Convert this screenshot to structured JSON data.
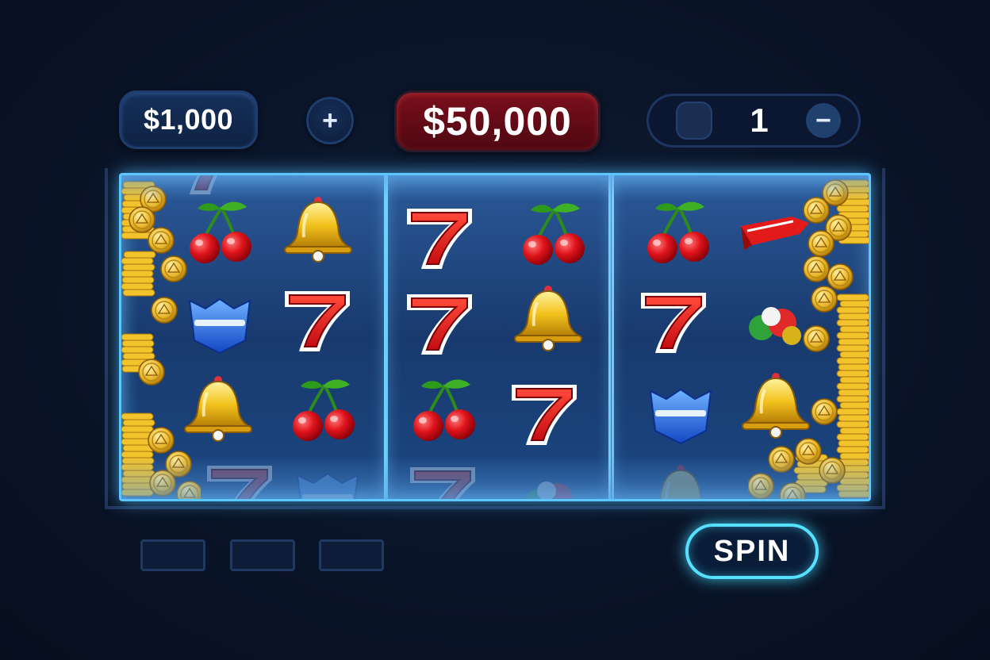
{
  "header": {
    "balance": "$1,000",
    "plus_label": "+",
    "jackpot": "$50,000",
    "lines_value": "1",
    "minus_label": "−"
  },
  "reels": [
    {
      "symbols": [
        "cherry",
        "bell",
        "blue-gem",
        "seven",
        "bell",
        "cherry"
      ]
    },
    {
      "symbols": [
        "seven",
        "cherry",
        "seven",
        "bell",
        "cherry",
        "seven"
      ]
    },
    {
      "symbols": [
        "cherry",
        "red-banner",
        "seven",
        "mixed-fruit",
        "blue-gem",
        "bell"
      ]
    }
  ],
  "bottom": {
    "spin_label": "SPIN",
    "slot_buttons": [
      "",
      "",
      ""
    ]
  },
  "colors": {
    "background": "#0a1428",
    "reel_glow": "#5cc7ff",
    "jackpot_red": "#7a0f1c",
    "spin_glow": "#56e0ff"
  }
}
